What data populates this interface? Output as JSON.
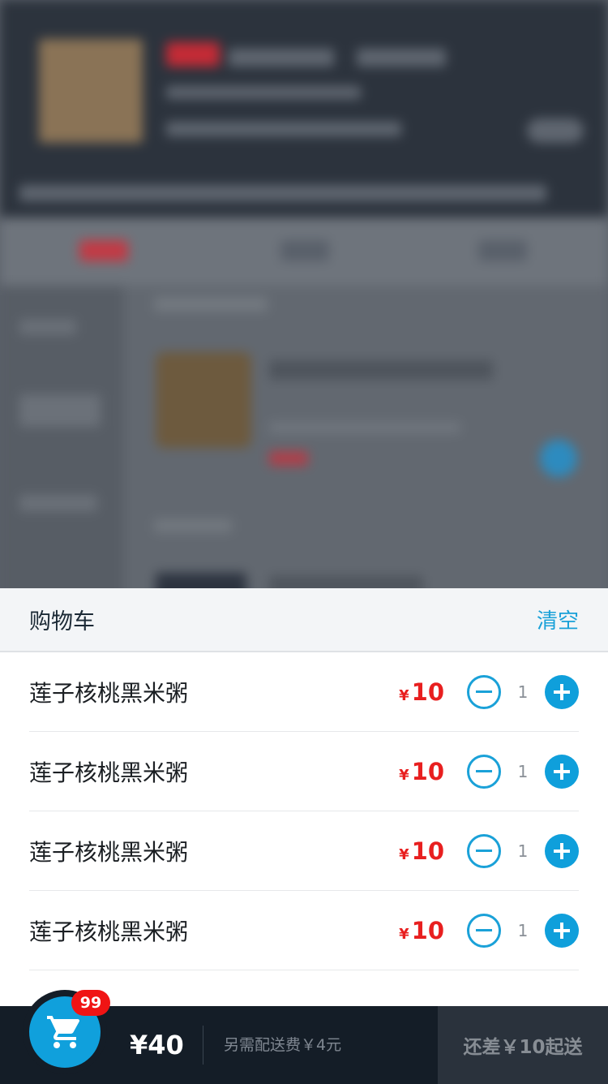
{
  "cart": {
    "title": "购物车",
    "clear_label": "清空",
    "items": [
      {
        "name": "莲子核桃黑米粥",
        "currency": "¥",
        "price": "10",
        "qty": "1"
      },
      {
        "name": "莲子核桃黑米粥",
        "currency": "¥",
        "price": "10",
        "qty": "1"
      },
      {
        "name": "莲子核桃黑米粥",
        "currency": "¥",
        "price": "10",
        "qty": "1"
      },
      {
        "name": "莲子核桃黑米粥",
        "currency": "¥",
        "price": "10",
        "qty": "1"
      }
    ]
  },
  "bottom_bar": {
    "badge_count": "99",
    "total": "¥40",
    "delivery_fee": "另需配送费￥4元",
    "min_order": "还差￥10起送"
  },
  "icons": {
    "cart_icon": "shopping-cart-icon",
    "minus_icon": "minus-circle-icon",
    "plus_icon": "plus-circle-icon"
  },
  "colors": {
    "accent": "#1aa1d8",
    "price": "#e81f1f",
    "bar_bg": "#141d27",
    "badge": "#f01414"
  }
}
